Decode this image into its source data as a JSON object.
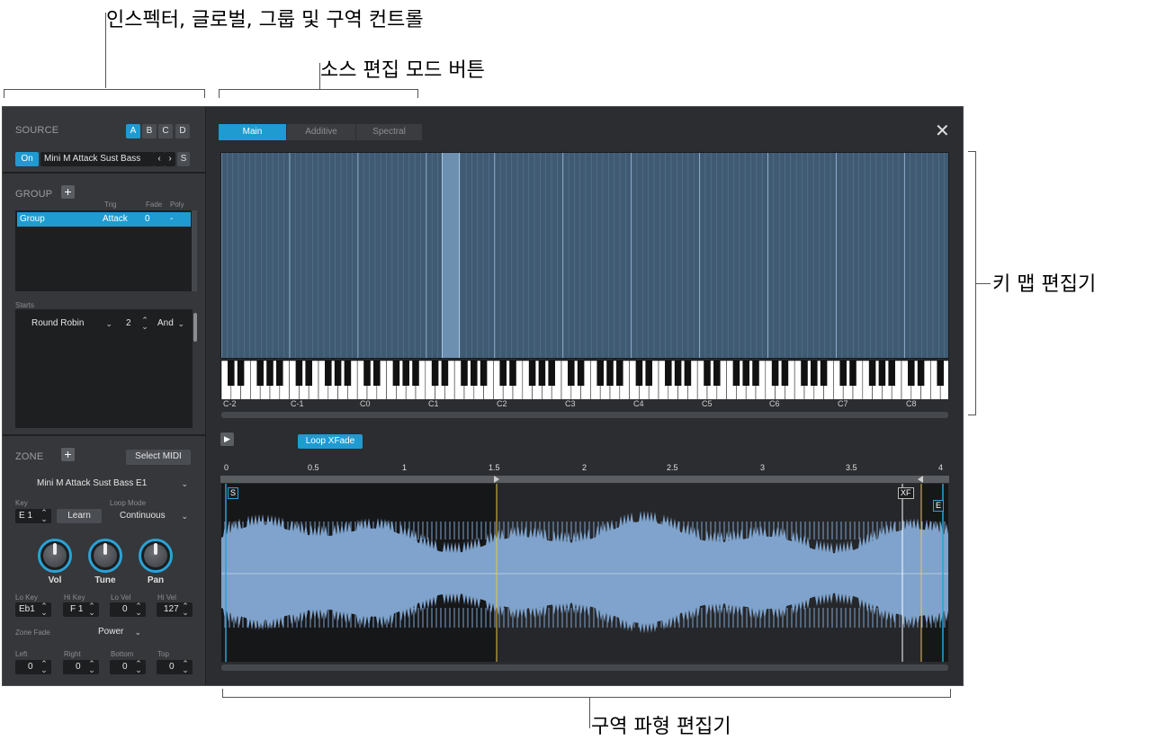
{
  "annotations": {
    "inspector": "인스펙터, 글로벌, 그룹 및 구역 컨트롤",
    "source_mode": "소스 편집 모드 버튼",
    "key_map": "키 맵 편집기",
    "zone_wave": "구역 파형 편집기"
  },
  "source": {
    "label": "SOURCE",
    "buttons": [
      "A",
      "B",
      "C",
      "D"
    ],
    "on_label": "On",
    "preset": "Mini M Attack Sust Bass",
    "prev": "‹",
    "next": "›",
    "s_label": "S"
  },
  "group": {
    "label": "GROUP",
    "cols": [
      "Trig",
      "Fade",
      "Poly"
    ],
    "row": {
      "name": "Group",
      "trig": "Attack",
      "fade": "0",
      "poly": "-"
    },
    "starts_label": "Starts",
    "mode": "Round Robin",
    "count": "2",
    "logic": "And"
  },
  "zone": {
    "label": "ZONE",
    "select_midi": "Select MIDI",
    "sample": "Mini M Attack Sust Bass E1",
    "key_label": "Key",
    "key": "E 1",
    "learn": "Learn",
    "loop_mode_label": "Loop Mode",
    "loop_mode": "Continuous",
    "knobs": [
      "Vol",
      "Tune",
      "Pan"
    ],
    "range_labels": [
      "Lo Key",
      "Hi Key",
      "Lo Vel",
      "Hi Vel"
    ],
    "range_values": [
      "Eb1",
      "F 1",
      "0",
      "127"
    ],
    "zone_fade_label": "Zone Fade",
    "zone_fade": "Power",
    "fade_labels": [
      "Left",
      "Right",
      "Bottom",
      "Top"
    ],
    "fade_values": [
      "0",
      "0",
      "0",
      "0"
    ]
  },
  "tabs": [
    "Main",
    "Additive",
    "Spectral"
  ],
  "close": "✕",
  "keymap": {
    "octaves": [
      "C-2",
      "C-1",
      "C0",
      "C1",
      "C2",
      "C3",
      "C4",
      "C5",
      "C6",
      "C7",
      "C8"
    ]
  },
  "wave": {
    "loop_button": "Loop XFade",
    "ruler": [
      "0",
      "0.5",
      "1",
      "1.5",
      "2",
      "2.5",
      "3",
      "3.5",
      "4"
    ],
    "start_flag": "S",
    "end_flag": "E",
    "xfade_flag": "XF"
  },
  "colors": {
    "accent": "#1f9bd1",
    "wave": "#7fa3cc",
    "loop_marker": "#e6c84a"
  }
}
